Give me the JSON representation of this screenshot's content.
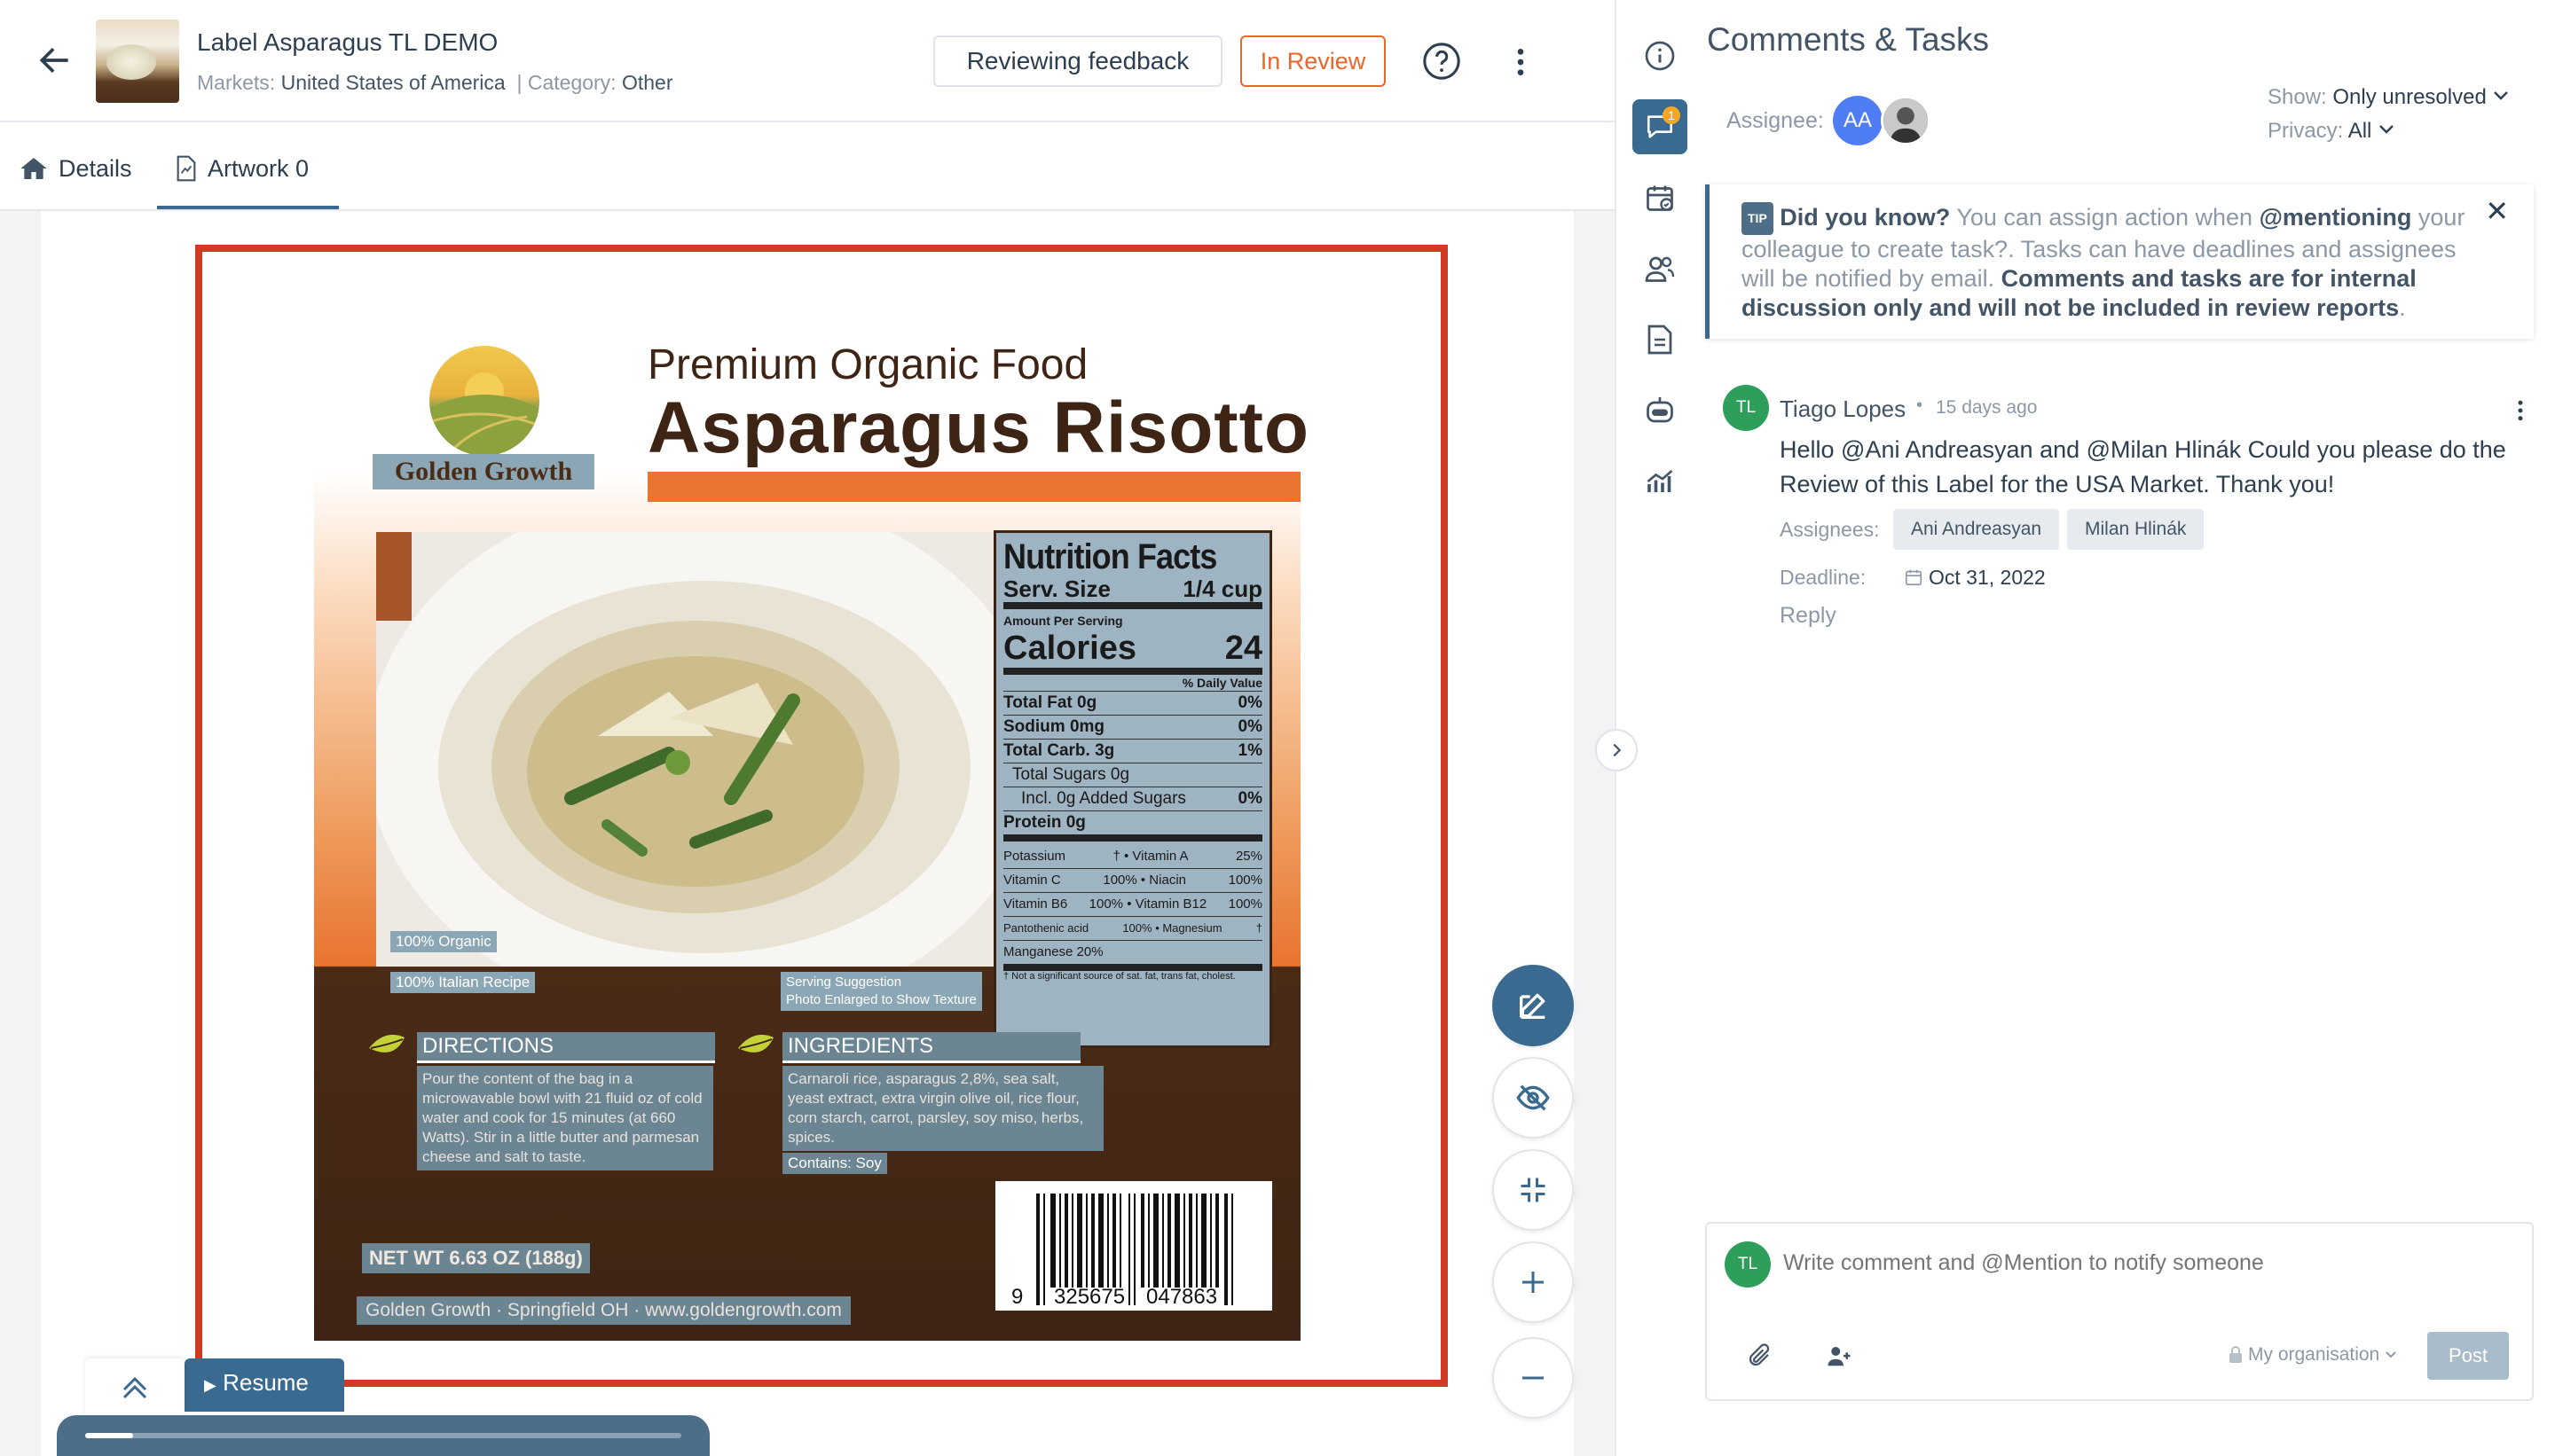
{
  "header": {
    "title": "Label Asparagus TL DEMO",
    "markets_label": "Markets:",
    "markets_value": "United States of America",
    "separator": "|",
    "category_label": "Category:",
    "category_value": "Other",
    "review_button": "Reviewing feedback",
    "status_button": "In Review",
    "status_color": "#e8672b"
  },
  "tabs": [
    {
      "label": "Details",
      "icon": "home-icon"
    },
    {
      "label": "Artwork 0",
      "icon": "document-icon",
      "active": true
    }
  ],
  "artwork": {
    "brand": "Golden Growth",
    "subtitle": "Premium Organic Food",
    "product": "Asparagus Risotto",
    "nutrition": {
      "title": "Nutrition Facts",
      "serv_label": "Serv. Size",
      "serv_value": "1/4 cup",
      "amount_per": "Amount Per Serving",
      "cal_label": "Calories",
      "cal_value": "24",
      "dv": "% Daily Value",
      "rows": [
        {
          "name": "Total Fat 0g",
          "pct": "0%"
        },
        {
          "name": "Sodium 0mg",
          "pct": "0%"
        },
        {
          "name": "Total Carb. 3g",
          "pct": "1%"
        },
        {
          "name": "Total Sugars 0g",
          "pct": ""
        },
        {
          "name": "Incl. 0g Added Sugars",
          "pct": "0%"
        },
        {
          "name": "Protein 0g",
          "pct": ""
        }
      ],
      "vit": [
        {
          "a": "Potassium",
          "b": "† • Vitamin A",
          "c": "25%"
        },
        {
          "a": "Vitamin C",
          "b": "100% • Niacin",
          "c": "100%"
        },
        {
          "a": "Vitamin B6",
          "b": "100% • Vitamin B12",
          "c": "100%"
        },
        {
          "a": "Pantothenic acid",
          "b": "100% • Magnesium",
          "c": "†"
        },
        {
          "a": "Manganese 20%",
          "b": "",
          "c": ""
        }
      ],
      "footnote": "† Not a significant source of sat. fat, trans fat, cholest."
    },
    "organic": "100% Organic",
    "recipe": "100% Italian Recipe",
    "serving1": "Serving Suggestion",
    "serving2": "Photo Enlarged to Show Texture",
    "directions_title": "DIRECTIONS",
    "directions_text": "Pour the content of the bag in a microwavable bowl with 21 fluid oz of cold water and cook for 15 minutes (at 660 Watts). Stir in a little butter and parmesan cheese and salt to taste.",
    "ingredients_title": "INGREDIENTS",
    "ingredients_text": "Carnaroli rice, asparagus 2,8%, sea salt, yeast extract, extra virgin olive oil, rice flour, corn starch, carrot, parsley, soy miso, herbs, spices.",
    "contains": "Contains: Soy",
    "net_wt": "NET WT 6.63 OZ (188g)",
    "footer": "Golden Growth · Springfield OH · www.goldengrowth.com",
    "barcode": {
      "d1": "9",
      "d2": "325675",
      "d3": "047863"
    }
  },
  "resume": {
    "label": "Resume",
    "progress": 0.08
  },
  "panel": {
    "title": "Comments & Tasks",
    "assignee_label": "Assignee:",
    "assignee_initials": "AA",
    "show_label": "Show:",
    "show_value": "Only unresolved",
    "privacy_label": "Privacy:",
    "privacy_value": "All",
    "notification_count": "1",
    "tip": {
      "badge": "TIP",
      "heading": "Did you know?",
      "text1": "You can assign action when",
      "mention": "@mentioning",
      "text2": "your colleague to create task?. Tasks can have deadlines and assignees will be notified by email.",
      "bold": "Comments and tasks are for internal discussion only and will not be included in review reports",
      "end": "."
    },
    "comment": {
      "initials": "TL",
      "author": "Tiago Lopes",
      "dot": "•",
      "time": "15 days ago",
      "text": "Hello @Ani Andreasyan and @Milan Hlinák Could you please do the Review of this Label for the USA Market. Thank you!",
      "assignees_label": "Assignees:",
      "assignees": [
        "Ani Andreasyan",
        "Milan Hlinák"
      ],
      "deadline_label": "Deadline:",
      "deadline": "Oct 31, 2022",
      "reply": "Reply"
    },
    "composer": {
      "initials": "TL",
      "placeholder": "Write comment and @Mention to notify someone",
      "org": "My organisation",
      "post": "Post"
    }
  },
  "colors": {
    "accent": "#3b6a90",
    "frame": "#d23a24",
    "avatar_green": "#2e9e5b",
    "avatar_blue": "#4f7df3"
  }
}
